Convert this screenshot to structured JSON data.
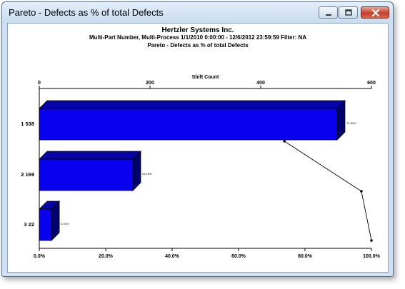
{
  "window": {
    "title": "Pareto - Defects as % of total Defects"
  },
  "report": {
    "company": "Hertzler Systems Inc.",
    "filter_line": "Multi-Part Number, Multi-Process   1/1/2010 0:00:00 - 12/6/2012 23:59:59   Filter: NA",
    "chart_title": "Pareto - Defects as % of total Defects"
  },
  "chart_data": {
    "type": "bar",
    "orientation": "horizontal",
    "categories": [
      "1  538",
      "2  169",
      "3  22"
    ],
    "values": [
      538,
      169,
      22
    ],
    "percent_labels": [
      "73.80%",
      "23.18%",
      "3.02%"
    ],
    "top_axis": {
      "label": "Shift Count",
      "range": [
        0,
        600
      ],
      "ticks": [
        "0",
        "200",
        "400",
        "600"
      ]
    },
    "bottom_axis": {
      "range": [
        0,
        100
      ],
      "ticks": [
        "0.0%",
        "20.0%",
        "40.0%",
        "60.0%",
        "80.0%",
        "100.0%"
      ]
    },
    "cumulative_percent": [
      73.8,
      96.98,
      100.0
    ],
    "bar_color": "#0a00f0",
    "bar_top_color": "#0404a8",
    "bar_side_color": "#00006e",
    "line_color": "#000000"
  }
}
